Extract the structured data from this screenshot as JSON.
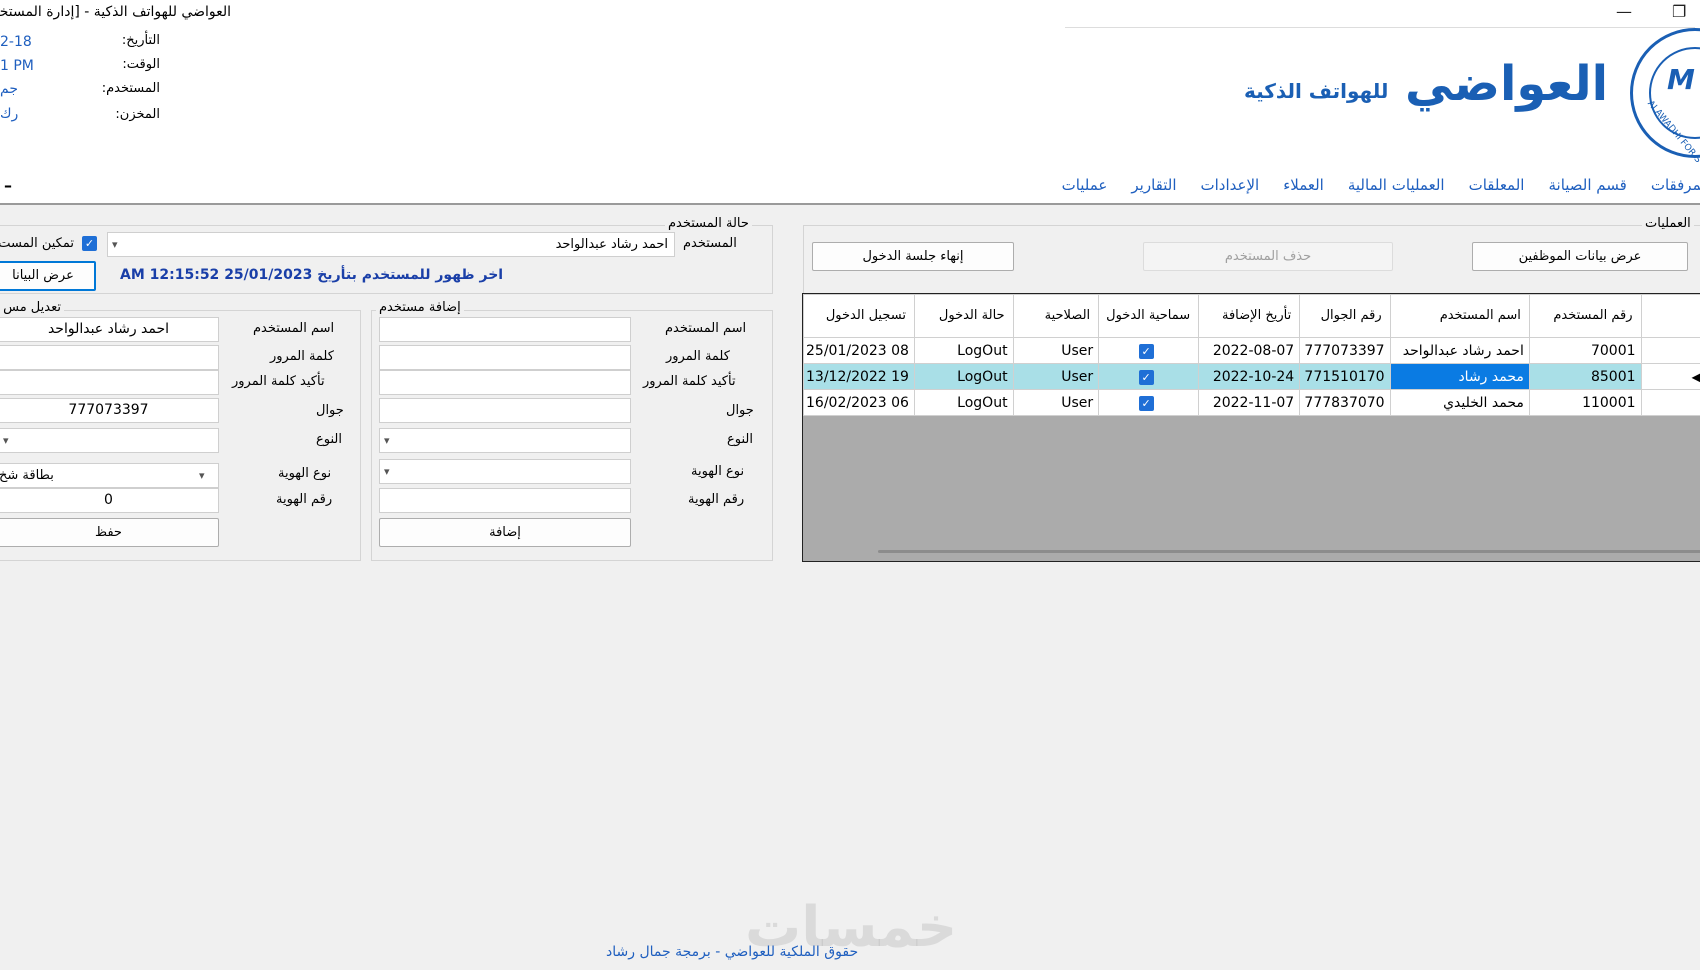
{
  "window": {
    "title": "العواضي للهواتف الذكية - [إدارة المستخدمين]",
    "minimize_glyph": "—",
    "restore_glyph": "❐"
  },
  "info": {
    "date_label": "التأريخ:",
    "date_value": "2-18",
    "time_label": "الوقت:",
    "time_value": "1 PM",
    "user_label": "المستخدم:",
    "user_value": "جم",
    "store_label": "المخزن:",
    "store_value": "رك"
  },
  "brand": {
    "main": "العواضي",
    "sub": "للهواتف الذكية",
    "logo_text": "M",
    "logo_ring_text": "ALAWADHI FOR S"
  },
  "menu": {
    "items": [
      "عمليات",
      "التقارير",
      "الإعدادات",
      "العملاء",
      "العمليات المالية",
      "المعلقات",
      "قسم الصيانة",
      "المرفقات"
    ],
    "dash": "–"
  },
  "operations": {
    "title": "العمليات",
    "show_employees_btn": "عرض بيانات الموظفين",
    "delete_user_btn": "حذف المستخدم",
    "end_session_btn": "إنهاء جلسة الدخول"
  },
  "grid": {
    "headers": {
      "user_no": "رقم المستخدم",
      "user_name": "اسم المستخدم",
      "mobile": "رقم الجوال",
      "add_date": "تأريخ الإضافة",
      "login_allowed": "سماحية الدخول",
      "permission": "الصلاحية",
      "login_status": "حالة الدخول",
      "login_record": "تسجيل الدخول"
    },
    "rows": [
      {
        "user_no": "70001",
        "user_name": "احمد رشاد عبدالواحد",
        "mobile": "777073397",
        "add_date": "2022-08-07",
        "permission": "User",
        "login_status": "LogOut",
        "login_record": "25/01/2023 08"
      },
      {
        "user_no": "85001",
        "user_name": "محمد رشاد",
        "mobile": "771510170",
        "add_date": "2022-10-24",
        "permission": "User",
        "login_status": "LogOut",
        "login_record": "13/12/2022 19"
      },
      {
        "user_no": "110001",
        "user_name": "محمد الخليدي",
        "mobile": "777837070",
        "add_date": "2022-11-07",
        "permission": "User",
        "login_status": "LogOut",
        "login_record": "16/02/2023 06"
      }
    ],
    "row_indicator": "◀"
  },
  "status": {
    "title": "حالة المستخدم",
    "user_label": "المستخدم",
    "user_value": "احمد رشاد عبدالواحد",
    "enable_label": "تمكين المست",
    "show_data_btn": "عرض البيانا",
    "last_seen": "اخر ظهور للمستخدم بتأريخ 25/01/2023 12:15:52 AM"
  },
  "add_user": {
    "title": "إضافة مستخدم",
    "username_label": "اسم المستخدم",
    "password_label": "كلمة المرور",
    "confirm_label": "تأكيد كلمة المرور",
    "mobile_label": "جوال",
    "type_label": "النوع",
    "id_type_label": "نوع الهوية",
    "id_no_label": "رقم الهوية",
    "add_btn": "إضافة"
  },
  "edit_user": {
    "title": "تعديل مس",
    "username_label": "اسم المستخدم",
    "username_value": "احمد رشاد عبدالواحد",
    "password_label": "كلمة المرور",
    "confirm_label": "تأكيد كلمة المرور",
    "mobile_label": "جوال",
    "mobile_value": "777073397",
    "type_label": "النوع",
    "id_type_label": "نوع الهوية",
    "id_type_value": "بطاقة شخ",
    "id_no_label": "رقم الهوية",
    "id_no_value": "0",
    "save_btn": "حفظ"
  },
  "footer": {
    "text": "حقوق الملكية للعواضي - برمجة جمال رشاد",
    "watermark": "خمسات"
  },
  "colors": {
    "accent": "#1a5fb4",
    "selection": "#0a7be3",
    "row_highlight": "#a9dfe7"
  }
}
